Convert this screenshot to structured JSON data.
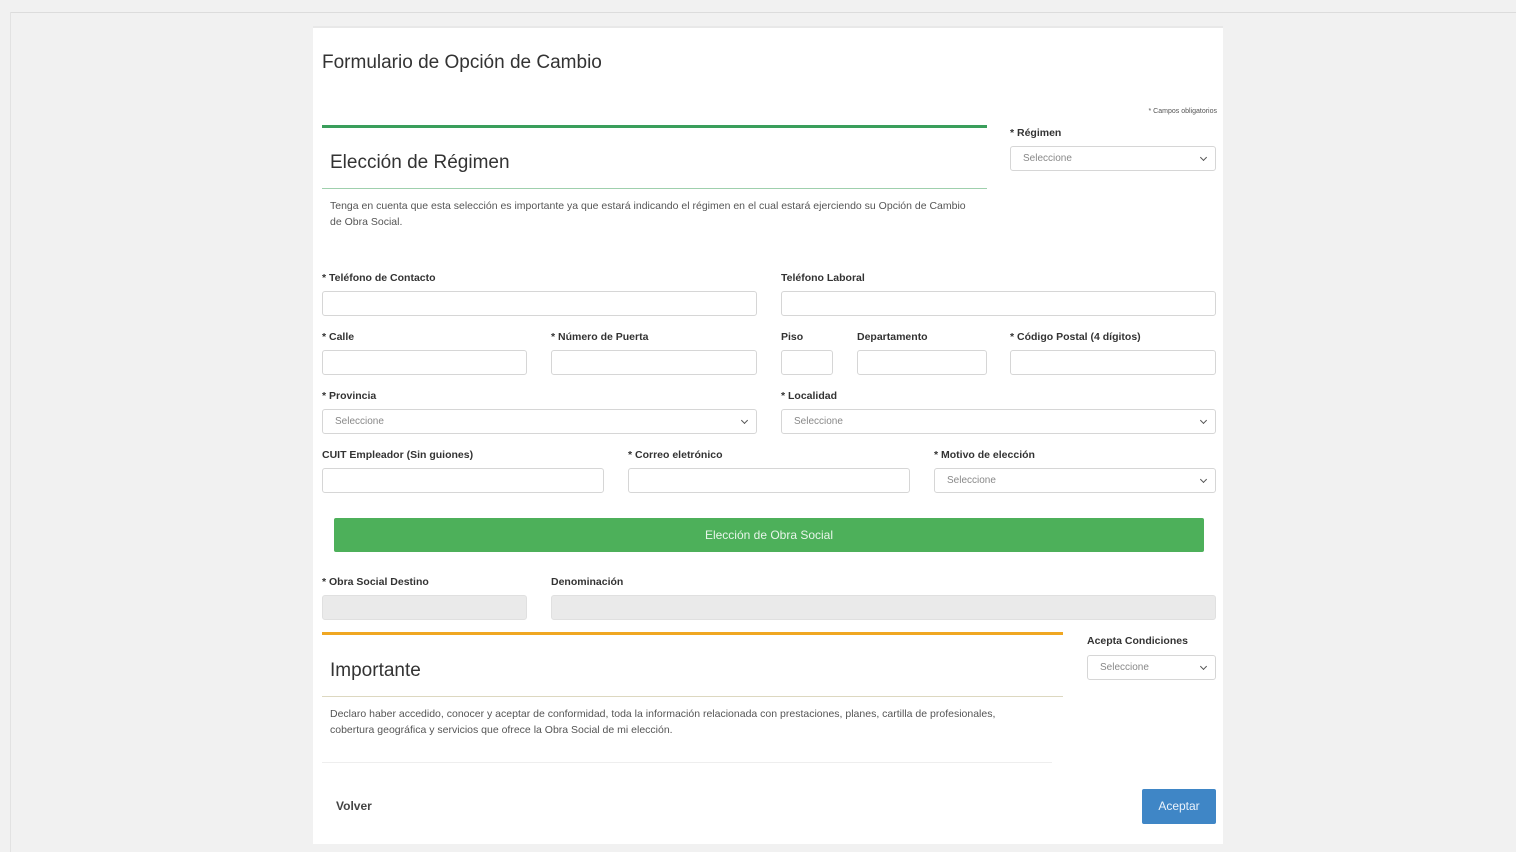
{
  "page": {
    "title": "Formulario de Opción de Cambio",
    "required_note": "* Campos obligatorios"
  },
  "regimen_section": {
    "heading": "Elección de Régimen",
    "description": "Tenga en cuenta que esta selección es importante ya que estará indicando el régimen en el cual estará ejerciendo su Opción de Cambio de Obra Social.",
    "regimen_label": "* Régimen",
    "regimen_value": "Seleccione"
  },
  "contact": {
    "telefono_contacto_label": "* Teléfono de Contacto",
    "telefono_laboral_label": "Teléfono Laboral"
  },
  "address": {
    "calle_label": "* Calle",
    "numero_puerta_label": "* Número de Puerta",
    "piso_label": "Piso",
    "departamento_label": "Departamento",
    "codigo_postal_label": "* Código Postal (4 dígitos)",
    "provincia_label": "* Provincia",
    "provincia_value": "Seleccione",
    "localidad_label": "* Localidad",
    "localidad_value": "Seleccione"
  },
  "employment": {
    "cuit_label": "CUIT Empleador (Sin guiones)",
    "correo_label": "* Correo eletrónico",
    "motivo_label": "* Motivo de elección",
    "motivo_value": "Seleccione"
  },
  "obra_social": {
    "button_label": "Elección de Obra Social",
    "destino_label": "* Obra Social Destino",
    "denominacion_label": "Denominación"
  },
  "importante": {
    "heading": "Importante",
    "text": "Declaro haber accedido, conocer y aceptar de conformidad, toda la información relacionada con prestaciones, planes, cartilla de profesionales, cobertura geográfica y servicios que ofrece la Obra Social de mi elección.",
    "acepta_label": "Acepta Condiciones",
    "acepta_value": "Seleccione"
  },
  "actions": {
    "back_label": "Volver",
    "accept_label": "Aceptar"
  },
  "colors": {
    "green_accent": "#3a9e5b",
    "green_button": "#4db05a",
    "orange_accent": "#f0a722",
    "blue_button": "#3f86c6"
  }
}
